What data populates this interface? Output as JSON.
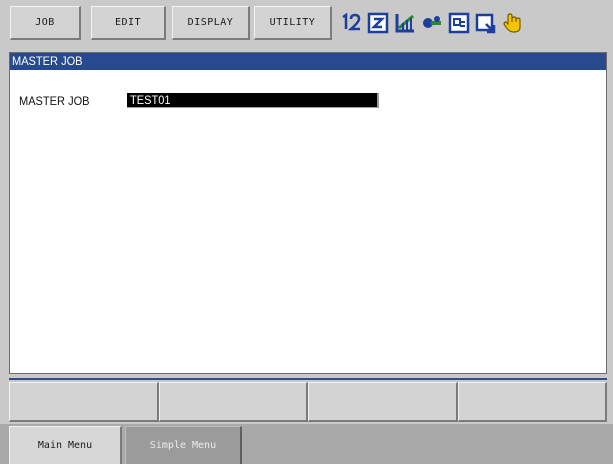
{
  "menu": {
    "job": "JOB",
    "edit": "EDIT",
    "display": "DISPLAY",
    "utility": "UTILITY"
  },
  "status_icons": [
    "number-1-2-icon",
    "edit-mode-icon",
    "coordinate-icon",
    "tool-icon",
    "program-icon",
    "step-icon",
    "hand-icon"
  ],
  "window": {
    "title": "MASTER JOB",
    "label": "MASTER JOB",
    "value": "TEST01"
  },
  "bottom": {
    "main_menu": "Main Menu",
    "simple_menu": "Simple Menu"
  },
  "colors": {
    "title_bar": "#274a8e",
    "background": "#c9c9c9",
    "field_bg": "#000000"
  }
}
